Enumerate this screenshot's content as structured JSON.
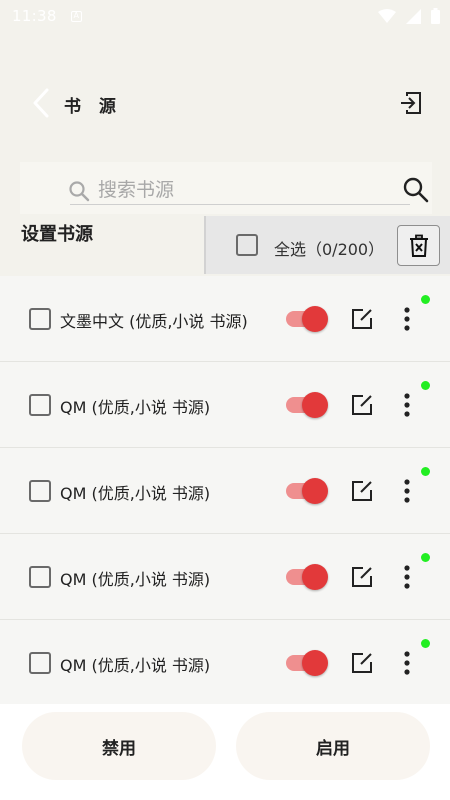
{
  "status_bar": {
    "time": "11:38",
    "notification_icon": "A",
    "icons": [
      "wifi-icon",
      "signal-icon",
      "battery-icon"
    ]
  },
  "header": {
    "title": "书 源",
    "back_icon": "chevron-left-icon",
    "import_icon": "import-icon"
  },
  "search": {
    "placeholder": "搜索书源",
    "value": ""
  },
  "section": {
    "label": "设置书源"
  },
  "select_bar": {
    "label": "全选（0/200）",
    "checked": false
  },
  "sources": [
    {
      "name": "文墨中文 (优质,小说 书源)",
      "enabled": true,
      "checked": false
    },
    {
      "name": "QM (优质,小说 书源)",
      "enabled": true,
      "checked": false
    },
    {
      "name": "QM (优质,小说 书源)",
      "enabled": true,
      "checked": false
    },
    {
      "name": "QM (优质,小说 书源)",
      "enabled": true,
      "checked": false
    },
    {
      "name": "QM (优质,小说 书源)",
      "enabled": true,
      "checked": false
    }
  ],
  "bottom": {
    "disable_label": "禁用",
    "enable_label": "启用"
  },
  "colors": {
    "background": "#f3f2ec",
    "toggle_track": "#ef8f8f",
    "toggle_thumb": "#e2393a",
    "status_dot": "#22ee22"
  }
}
